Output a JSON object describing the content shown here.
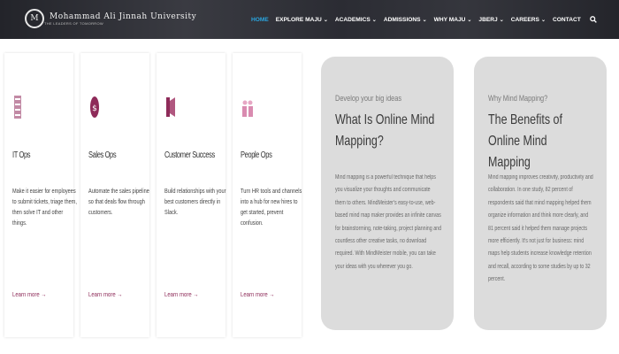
{
  "header": {
    "logo_seal": "M",
    "university_name": "Mohammad Ali Jinnah University",
    "university_tagline": "THE LEADERS OF TOMORROW",
    "nav": [
      {
        "label": "HOME",
        "dropdown": false,
        "active": true
      },
      {
        "label": "EXPLORE MAJU",
        "dropdown": true
      },
      {
        "label": "ACADEMICS",
        "dropdown": true
      },
      {
        "label": "ADMISSIONS",
        "dropdown": true
      },
      {
        "label": "WHY MAJU",
        "dropdown": true
      },
      {
        "label": "JBERJ",
        "dropdown": true
      },
      {
        "label": "CAREERS",
        "dropdown": true
      },
      {
        "label": "CONTACT",
        "dropdown": false
      }
    ],
    "search_icon": "search-icon"
  },
  "cards": [
    {
      "title": "IT Ops",
      "icon": "server-icon",
      "desc": "Make it easier for employees to submit tickets, triage them, then solve IT and other things.",
      "link": "Learn more"
    },
    {
      "title": "Sales Ops",
      "icon": "dollar-icon",
      "desc": "Automate the sales pipeline so that deals flow through customers.",
      "link": "Learn more"
    },
    {
      "title": "Customer Success",
      "icon": "bookmark-icon",
      "desc": "Build relationships with your best customers directly in Slack.",
      "link": "Learn more"
    },
    {
      "title": "People Ops",
      "icon": "people-icon",
      "desc": "Turn HR tools and channels into a hub for new hires to get started, prevent confusion.",
      "link": "Learn more"
    }
  ],
  "panels": [
    {
      "kicker": "Develop your big ideas",
      "heading": "What Is Online Mind Mapping?",
      "body": "Mind mapping is a powerful technique that helps you visualize your thoughts and communicate them to others. MindMeister's easy-to-use, web-based mind map maker provides an infinite canvas for brainstorming, note-taking, project planning and countless other creative tasks, no download required. With MindMeister mobile, you can take your ideas with you wherever you go."
    },
    {
      "kicker": "Why Mind Mapping?",
      "heading": "The Benefits of Online Mind Mapping",
      "body": "Mind mapping improves creativity, productivity and collaboration. In one study, 82 percent of respondents said that mind mapping helped them organize information and think more clearly, and 81 percent said it helped them manage projects more efficiently. It's not just for business: mind maps help students increase knowledge retention and recall, according to some studies by up to 32 percent."
    }
  ],
  "colors": {
    "accent": "#8e2b59",
    "active_nav": "#2aa6e0",
    "panel": "#dcdcdc"
  }
}
